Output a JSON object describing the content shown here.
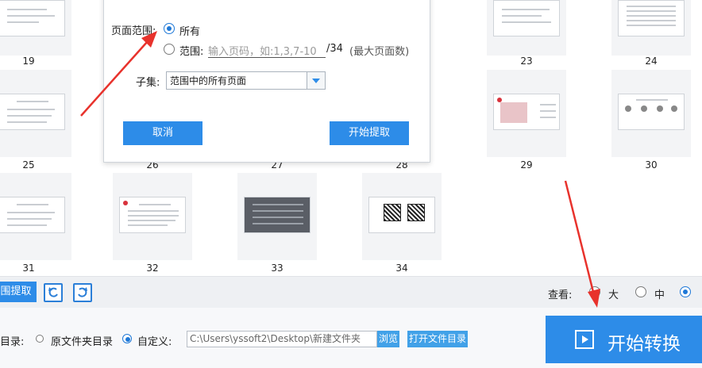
{
  "thumbnails": {
    "pages": [
      {
        "number": "19"
      },
      {
        "number": "23"
      },
      {
        "number": "24"
      },
      {
        "number": "25"
      },
      {
        "number": "26"
      },
      {
        "number": "27"
      },
      {
        "number": "28"
      },
      {
        "number": "29"
      },
      {
        "number": "30"
      },
      {
        "number": "31"
      },
      {
        "number": "32"
      },
      {
        "number": "33"
      },
      {
        "number": "34"
      }
    ]
  },
  "dialog": {
    "page_range_label": "页面范围:",
    "option_all": "所有",
    "option_range": "范围:",
    "range_placeholder": "输入页码，如:1,3,7-10",
    "total_pages": "/34",
    "max_pages_note": "(最大页面数)",
    "subset_label": "子集:",
    "subset_value": "范围中的所有页面",
    "cancel_label": "取消",
    "extract_label": "开始提取"
  },
  "toolbar": {
    "range_extract_label": "围提取",
    "view_label": "查看:",
    "view_large": "大",
    "view_medium": "中"
  },
  "bottom": {
    "output_dir_label": "目录:",
    "option_source_dir": "原文件夹目录",
    "option_custom": "自定义:",
    "path_value": "C:\\Users\\yssoft2\\Desktop\\新建文件夹",
    "browse_label": "浏览",
    "open_folder_label": "打开文件目录",
    "start_convert_label": "开始转换"
  },
  "colors": {
    "accent": "#2d8ce8",
    "arrow": "#e8322c"
  }
}
